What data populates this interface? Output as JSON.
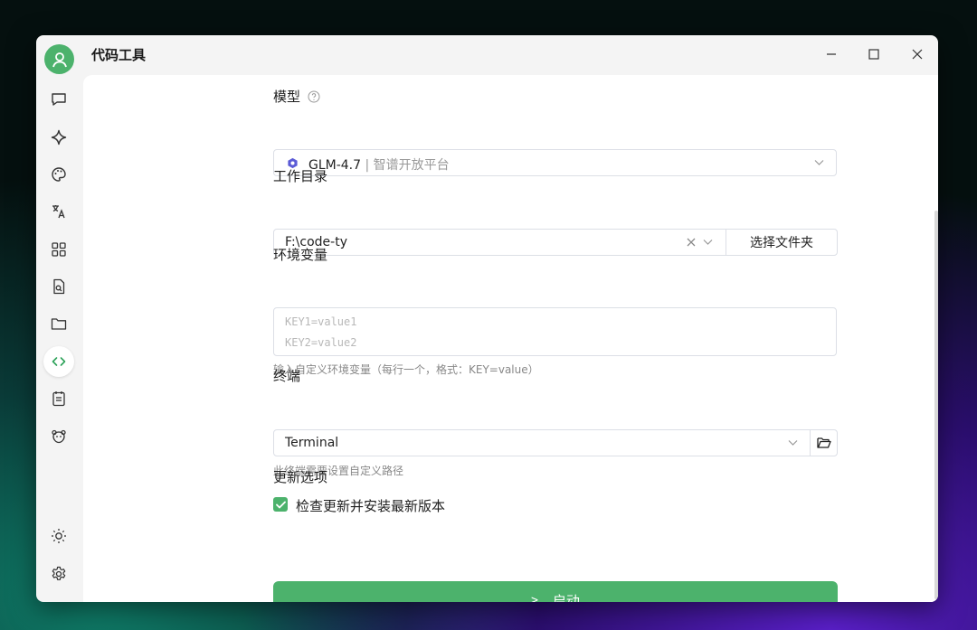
{
  "app": {
    "title": "代码工具"
  },
  "window_controls": {
    "minimize": "minimize-icon",
    "maximize": "maximize-icon",
    "close": "close-icon"
  },
  "sidebar": {
    "items": [
      {
        "icon": "chat-icon"
      },
      {
        "icon": "sparkle-icon"
      },
      {
        "icon": "palette-icon"
      },
      {
        "icon": "translate-icon"
      },
      {
        "icon": "apps-grid-icon"
      },
      {
        "icon": "file-search-icon"
      },
      {
        "icon": "folder-icon"
      },
      {
        "icon": "code-icon",
        "active": true
      },
      {
        "icon": "notes-icon"
      },
      {
        "icon": "bear-icon"
      }
    ],
    "bottom": [
      {
        "icon": "brightness-icon"
      },
      {
        "icon": "settings-icon"
      }
    ]
  },
  "form": {
    "model": {
      "label": "模型",
      "selected_name": "GLM-4.7",
      "selected_sep": " | ",
      "selected_provider": "智谱开放平台"
    },
    "workdir": {
      "label": "工作目录",
      "value": "F:\\code-ty",
      "choose_button": "选择文件夹"
    },
    "env": {
      "label": "环境变量",
      "placeholder_line1": "KEY1=value1",
      "placeholder_line2": "KEY2=value2",
      "hint": "输入自定义环境变量（每行一个，格式：KEY=value）"
    },
    "terminal": {
      "label": "终端",
      "value": "Terminal",
      "hint": "此终端需要设置自定义路径"
    },
    "update": {
      "label": "更新选项",
      "checkbox_label": "检查更新并安装最新版本",
      "checked": true
    },
    "launch_button": "启动",
    "launch_prefix": ">_"
  },
  "colors": {
    "accent": "#4cb26c",
    "model_icon": "#5b5bd6"
  }
}
